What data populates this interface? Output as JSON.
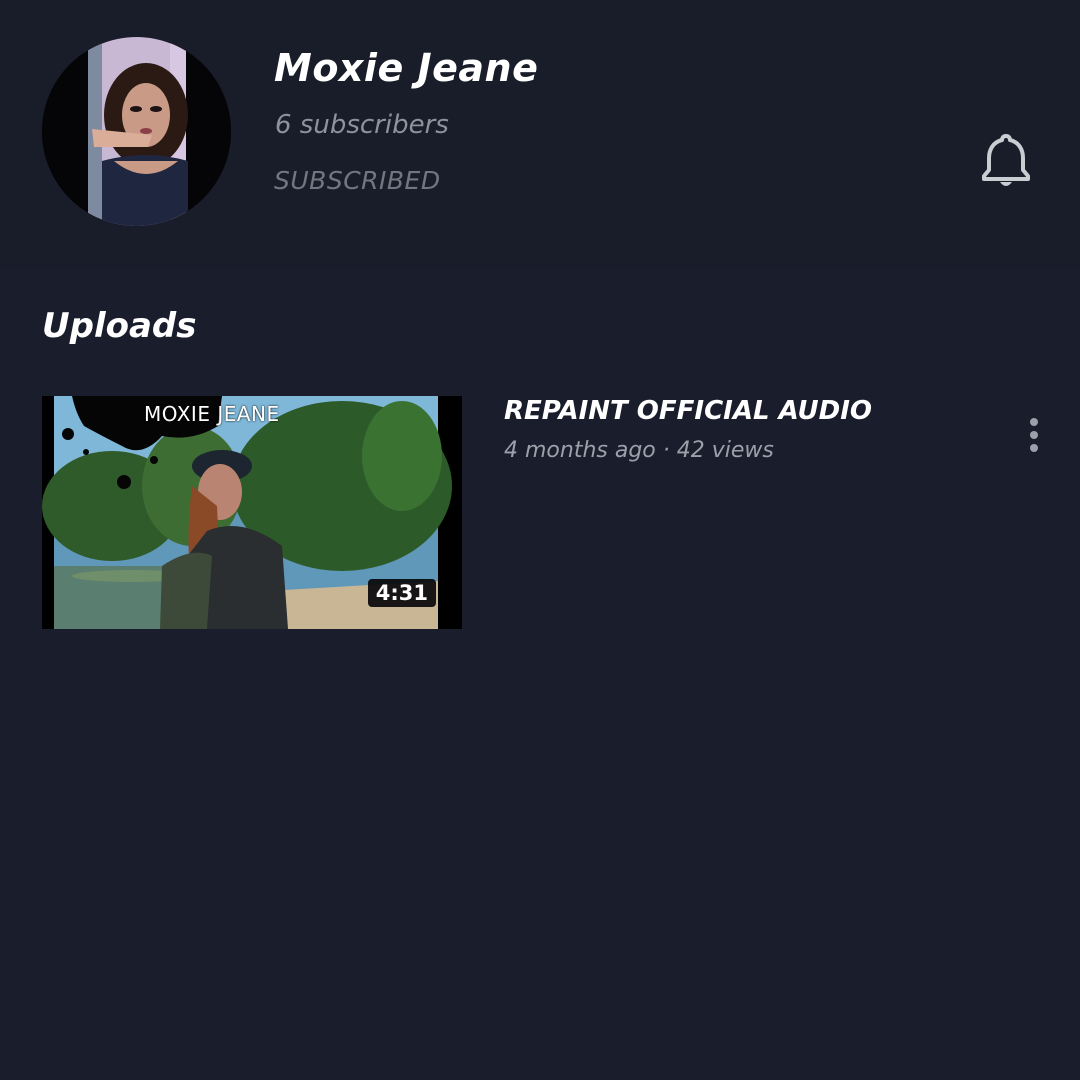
{
  "channel": {
    "name": "Moxie Jeane",
    "subscribers": "6 subscribers",
    "subscription_status": "SUBSCRIBED",
    "avatar_icon": "profile-photo",
    "notification_icon": "bell-icon"
  },
  "uploads": {
    "title": "Uploads",
    "videos": [
      {
        "title": "REPAINT OFFICIAL AUDIO",
        "meta": "4 months ago · 42 views",
        "duration": "4:31",
        "thumbnail_text": "MOXIE JEANE",
        "menu_icon": "more-vert-icon"
      }
    ]
  },
  "colors": {
    "background": "#1a1e2c",
    "header_background": "#191d29",
    "primary_text": "#ffffff",
    "secondary_text": "#8b939c"
  }
}
